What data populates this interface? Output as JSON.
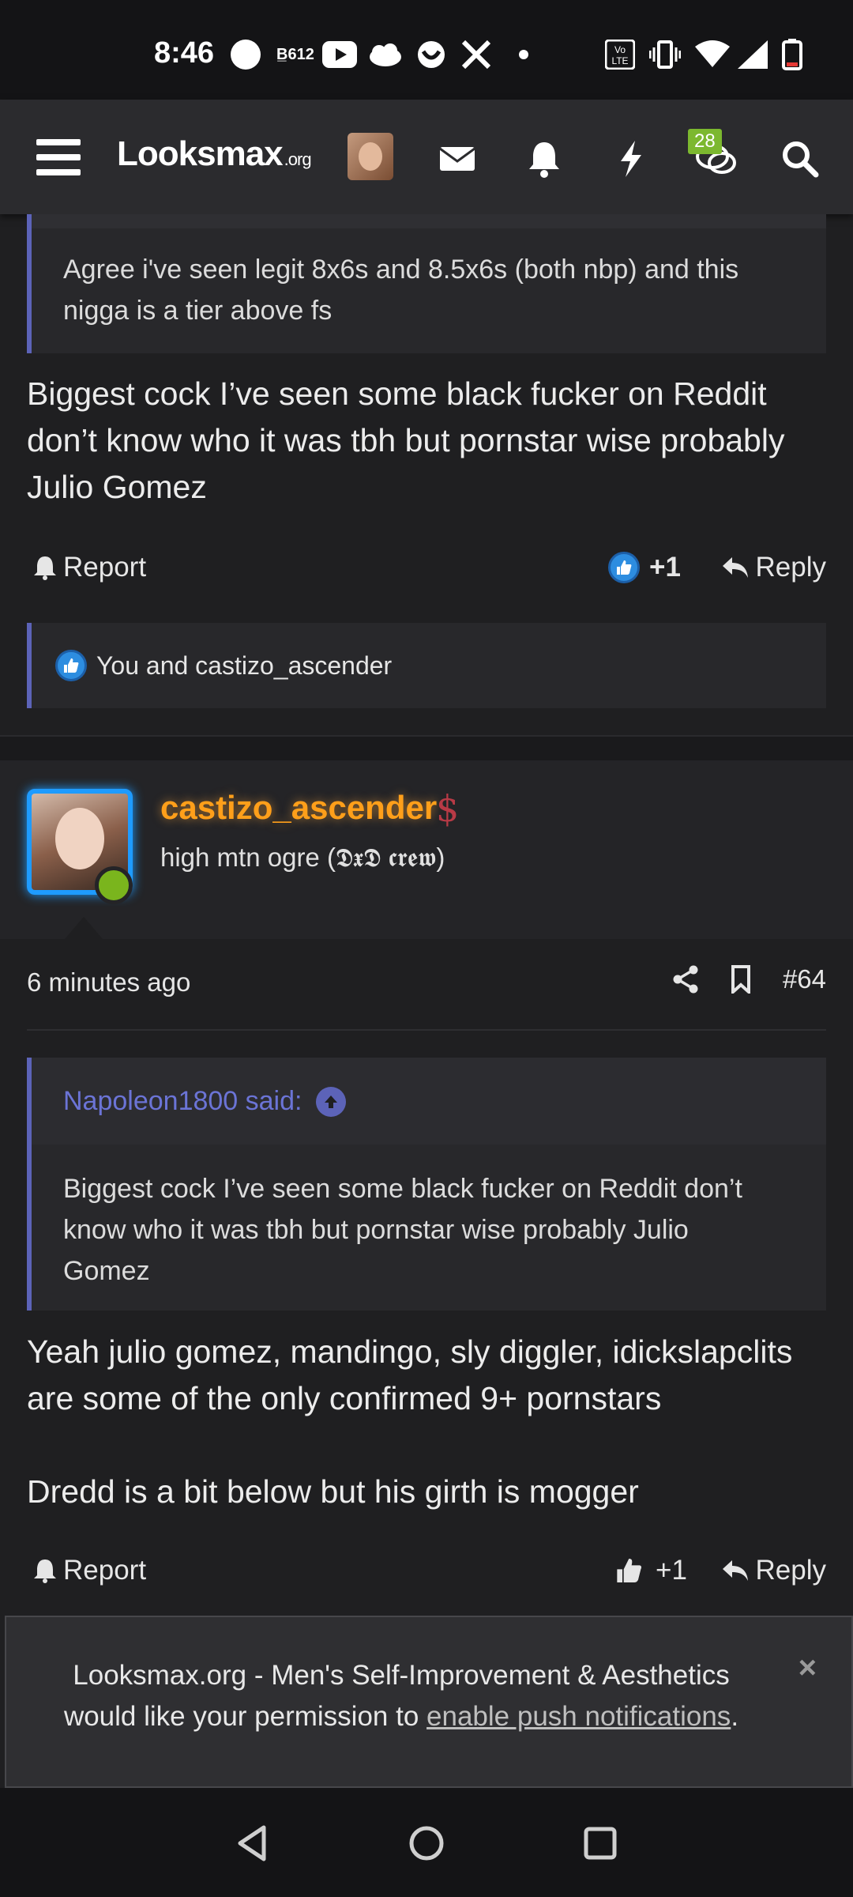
{
  "status_bar": {
    "time": "8:46",
    "icons": [
      "spotify-icon",
      "bbc-icon",
      "youtube-icon",
      "klarna-icon",
      "smile-icon",
      "x-icon",
      "dot-icon",
      "volte-icon",
      "vibrate-icon",
      "wifi-icon",
      "signal-icon",
      "battery-icon"
    ],
    "volte_label": "Vo LTE"
  },
  "header": {
    "logo_main": "Looksmax",
    "logo_suffix": ".org",
    "notification_count": "28",
    "icons": [
      "menu-icon",
      "mail-icon",
      "bell-icon",
      "bolt-icon",
      "chat-icon",
      "search-icon"
    ]
  },
  "post1": {
    "quote_text_line1": "Agree i've seen legit 8x6s and 8.5x6s (both nbp) and this",
    "quote_text_line2": "nigga is a tier above fs",
    "body_line1": "Biggest cock I’ve seen some black fucker on Reddit",
    "body_line2": "don’t know who it was tbh but pornstar wise probably",
    "body_line3": "Julio Gomez",
    "report_label": "Report",
    "like_count": "+1",
    "reply_label": "Reply",
    "reactions_text": "You and castizo_ascender"
  },
  "post2": {
    "username": "castizo_ascender",
    "user_title": "high mtn ogre (𝕯𝖝𝕯 𝖈𝖗𝖊𝖜)",
    "dollar_symbol": "$",
    "timestamp": "6 minutes ago",
    "post_number": "#64",
    "quote_author": "Napoleon1800 said:",
    "quote_line1": "Biggest cock I’ve seen some black fucker on Reddit don’t",
    "quote_line2": "know who it was tbh but pornstar wise probably Julio",
    "quote_line3": "Gomez",
    "body_line1": "Yeah julio gomez, mandingo, sly diggler, idickslapclits",
    "body_line2": "are some of the only confirmed 9+ pornstars",
    "body_line3": "Dredd is a bit below but his girth is mogger",
    "report_label": "Report",
    "like_count": "+1",
    "reply_label": "Reply"
  },
  "push_banner": {
    "line1": "Looksmax.org - Men's Self-Improvement & Aesthetics",
    "line2_prefix": "would like your permission to ",
    "link_text": "enable push notifications",
    "line2_suffix": ".",
    "close_label": "×"
  },
  "colors": {
    "accent_blue": "#5c63b8",
    "username_orange": "#ff9f1a",
    "badge_green": "#7cb82f",
    "online_green": "#7ab51d",
    "avatar_border": "#1e9bff"
  }
}
